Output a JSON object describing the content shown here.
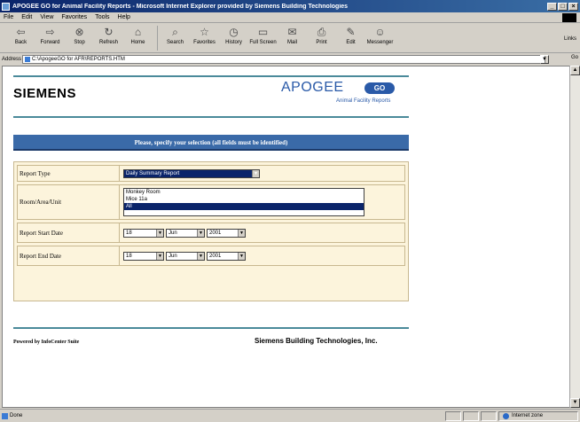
{
  "window": {
    "title": "APOGEE GO for Animal Facility Reports - Microsoft Internet Explorer provided by Siemens Building Technologies",
    "minimize": "_",
    "maximize": "□",
    "close": "×"
  },
  "menu": [
    "File",
    "Edit",
    "View",
    "Favorites",
    "Tools",
    "Help"
  ],
  "toolbar": {
    "buttons": [
      {
        "label": "Back",
        "icon": "back-arrow-icon",
        "glyph": "⇦"
      },
      {
        "label": "Forward",
        "icon": "forward-arrow-icon",
        "glyph": "⇨"
      },
      {
        "label": "Stop",
        "icon": "stop-icon",
        "glyph": "⊗"
      },
      {
        "label": "Refresh",
        "icon": "refresh-icon",
        "glyph": "↻"
      },
      {
        "label": "Home",
        "icon": "home-icon",
        "glyph": "⌂"
      },
      {
        "label": "Search",
        "icon": "search-icon",
        "glyph": "⌕"
      },
      {
        "label": "Favorites",
        "icon": "favorites-icon",
        "glyph": "☆"
      },
      {
        "label": "History",
        "icon": "history-icon",
        "glyph": "◷"
      },
      {
        "label": "Full Screen",
        "icon": "fullscreen-icon",
        "glyph": "▭"
      },
      {
        "label": "Mail",
        "icon": "mail-icon",
        "glyph": "✉"
      },
      {
        "label": "Print",
        "icon": "print-icon",
        "glyph": "⎙"
      },
      {
        "label": "Edit",
        "icon": "edit-icon",
        "glyph": "✎"
      },
      {
        "label": "Messenger",
        "icon": "messenger-icon",
        "glyph": "☺"
      }
    ],
    "links": "Links"
  },
  "address": {
    "label": "Address",
    "url": "C:\\ApogeeGO for AFR\\REPORTS.HTM",
    "go": "Go"
  },
  "header": {
    "logo": "SIEMENS",
    "apogee": "APOGEE",
    "go_badge": "GO",
    "subtitle": "Animal Facility Reports"
  },
  "instruction": "Please, specify your selection (all fields must be identified)",
  "form": {
    "report_type": {
      "label": "Report Type",
      "value": "Daily Summary Report"
    },
    "room": {
      "label": "Room/Area/Unit",
      "options": [
        "Monkey Room",
        "Mice 11a",
        "All"
      ],
      "selected": "All"
    },
    "start_date": {
      "label": "Report Start Date",
      "day": "18",
      "month": "Jun",
      "year": "2001"
    },
    "end_date": {
      "label": "Report End Date",
      "day": "18",
      "month": "Jun",
      "year": "2001"
    }
  },
  "footer": {
    "powered_by": "Powered by InfoCenter Suite",
    "company": "Siemens Building Technologies, Inc."
  },
  "status": {
    "text": "Done",
    "zone": "Internet zone"
  },
  "colors": {
    "title_bar": "#0a246a",
    "banner": "#3a6aa8",
    "form_bg": "#fcf4dc",
    "rule": "#4a8a9a",
    "brand_blue": "#2a5aa8"
  }
}
